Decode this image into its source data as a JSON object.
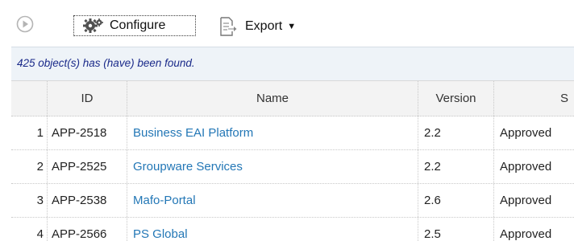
{
  "toolbar": {
    "configure_label": "Configure",
    "export_label": "Export"
  },
  "info": {
    "message": "425 object(s) has (have) been found."
  },
  "table": {
    "columns": [
      "ID",
      "Name",
      "Version",
      "S"
    ],
    "rows": [
      {
        "num": "1",
        "id": "APP-2518",
        "name": "Business EAI Platform",
        "version": "2.2",
        "status": "Approved"
      },
      {
        "num": "2",
        "id": "APP-2525",
        "name": "Groupware Services",
        "version": "2.2",
        "status": "Approved"
      },
      {
        "num": "3",
        "id": "APP-2538",
        "name": "Mafo-Portal",
        "version": "2.6",
        "status": "Approved"
      },
      {
        "num": "4",
        "id": "APP-2566",
        "name": "PS Global",
        "version": "2.5",
        "status": "Approved"
      }
    ]
  },
  "icons": {
    "play": "play-circle-icon",
    "configure": "gear-icon",
    "export": "export-document-icon",
    "caret": "caret-down-icon"
  },
  "colors": {
    "link": "#2377b6",
    "info_text": "#1a2a8a",
    "info_bg": "#eef3f8",
    "header_bg": "#f3f3f3"
  }
}
